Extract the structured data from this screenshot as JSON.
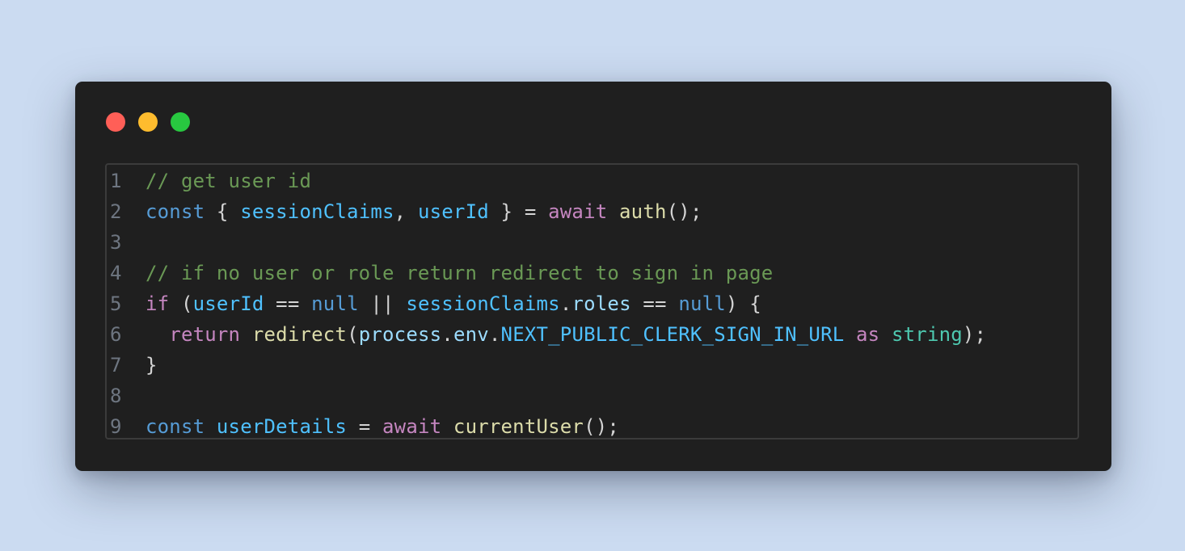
{
  "window": {
    "traffic_lights": [
      {
        "name": "close",
        "color": "#ff5f57"
      },
      {
        "name": "minimize",
        "color": "#febc2e"
      },
      {
        "name": "zoom",
        "color": "#28c840"
      }
    ]
  },
  "code": {
    "language": "typescript",
    "lines": [
      {
        "number": "1",
        "tokens": [
          {
            "text": "// get user id",
            "kind": "comment"
          }
        ]
      },
      {
        "number": "2",
        "tokens": [
          {
            "text": "const",
            "kind": "keyword"
          },
          {
            "text": " { ",
            "kind": "punct"
          },
          {
            "text": "sessionClaims",
            "kind": "var"
          },
          {
            "text": ", ",
            "kind": "punct"
          },
          {
            "text": "userId",
            "kind": "var"
          },
          {
            "text": " } = ",
            "kind": "punct"
          },
          {
            "text": "await",
            "kind": "control"
          },
          {
            "text": " ",
            "kind": "punct"
          },
          {
            "text": "auth",
            "kind": "func"
          },
          {
            "text": "();",
            "kind": "punct"
          }
        ]
      },
      {
        "number": "3",
        "tokens": []
      },
      {
        "number": "4",
        "tokens": [
          {
            "text": "// if no user or role return redirect to sign in page",
            "kind": "comment"
          }
        ]
      },
      {
        "number": "5",
        "tokens": [
          {
            "text": "if",
            "kind": "control"
          },
          {
            "text": " (",
            "kind": "punct"
          },
          {
            "text": "userId",
            "kind": "var"
          },
          {
            "text": " == ",
            "kind": "punct"
          },
          {
            "text": "null",
            "kind": "keyword"
          },
          {
            "text": " || ",
            "kind": "punct"
          },
          {
            "text": "sessionClaims",
            "kind": "var"
          },
          {
            "text": ".",
            "kind": "punct"
          },
          {
            "text": "roles",
            "kind": "prop"
          },
          {
            "text": " == ",
            "kind": "punct"
          },
          {
            "text": "null",
            "kind": "keyword"
          },
          {
            "text": ") {",
            "kind": "punct"
          }
        ]
      },
      {
        "number": "6",
        "tokens": [
          {
            "text": "  ",
            "kind": "punct"
          },
          {
            "text": "return",
            "kind": "control"
          },
          {
            "text": " ",
            "kind": "punct"
          },
          {
            "text": "redirect",
            "kind": "func"
          },
          {
            "text": "(",
            "kind": "punct"
          },
          {
            "text": "process",
            "kind": "prop"
          },
          {
            "text": ".",
            "kind": "punct"
          },
          {
            "text": "env",
            "kind": "prop"
          },
          {
            "text": ".",
            "kind": "punct"
          },
          {
            "text": "NEXT_PUBLIC_CLERK_SIGN_IN_URL",
            "kind": "const"
          },
          {
            "text": " ",
            "kind": "punct"
          },
          {
            "text": "as",
            "kind": "control"
          },
          {
            "text": " ",
            "kind": "punct"
          },
          {
            "text": "string",
            "kind": "type"
          },
          {
            "text": ");",
            "kind": "punct"
          }
        ]
      },
      {
        "number": "7",
        "tokens": [
          {
            "text": "}",
            "kind": "punct"
          }
        ]
      },
      {
        "number": "8",
        "tokens": []
      },
      {
        "number": "9",
        "tokens": [
          {
            "text": "const",
            "kind": "keyword"
          },
          {
            "text": " ",
            "kind": "punct"
          },
          {
            "text": "userDetails",
            "kind": "var"
          },
          {
            "text": " = ",
            "kind": "punct"
          },
          {
            "text": "await",
            "kind": "control"
          },
          {
            "text": " ",
            "kind": "punct"
          },
          {
            "text": "currentUser",
            "kind": "func"
          },
          {
            "text": "();",
            "kind": "punct"
          }
        ]
      }
    ]
  }
}
